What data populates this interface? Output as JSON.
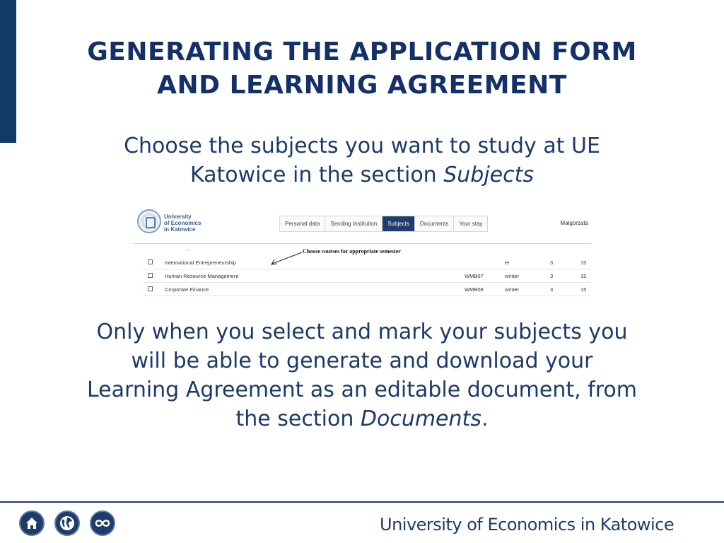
{
  "slide": {
    "title_line1": "GENERATING THE APPLICATION FORM",
    "title_line2": "AND LEARNING AGREEMENT",
    "subtitle_line1": "Choose the subjects you want to study at UE",
    "subtitle_line2_prefix": "Katowice in the section ",
    "subtitle_line2_em": "Subjects",
    "body_line1": "Only when you select and mark your subjects you",
    "body_line2": "will be able to generate and download your",
    "body_line3": "Learning Agreement as an editable document, from",
    "body_line4_prefix": "the section ",
    "body_line4_em": "Documents",
    "body_line4_suffix": "."
  },
  "screenshot": {
    "logo": {
      "line1": "University",
      "line2": "of Economics",
      "line3": "in Katowice"
    },
    "tabs": [
      {
        "label": "Personal data",
        "active": false
      },
      {
        "label": "Sending Institution",
        "active": false
      },
      {
        "label": "Subjects",
        "active": true
      },
      {
        "label": "Documents",
        "active": false
      },
      {
        "label": "Your stay",
        "active": false
      }
    ],
    "user_name": "Małgorzata",
    "dash": "-",
    "instruction": "Choose courses for appropriate semester",
    "rows": [
      {
        "name": "International Entrepreneurship",
        "code": "",
        "semester": "er",
        "hours": "3",
        "ects": "15"
      },
      {
        "name": "Human Resource Management",
        "code": "WMB07",
        "semester": "winter",
        "hours": "3",
        "ects": "15"
      },
      {
        "name": "Corporate Finance",
        "code": "WMB08",
        "semester": "winter",
        "hours": "3",
        "ects": "15"
      }
    ]
  },
  "footer": {
    "icons": [
      "home-icon",
      "globe-icon",
      "infinity-icon"
    ],
    "brand": "University of Economics in Katowice"
  },
  "colors": {
    "navy": "#143068",
    "active_tab": "#1f3d6e"
  }
}
